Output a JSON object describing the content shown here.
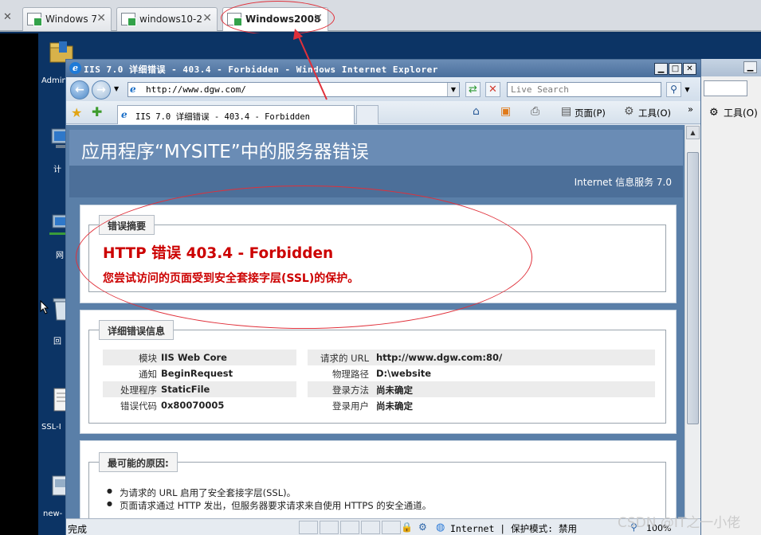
{
  "vm_tabs": [
    {
      "label": "Windows 7",
      "close": "✕"
    },
    {
      "label": "windows10-2",
      "close": "✕"
    },
    {
      "label": "Windows2008",
      "close": "✕"
    }
  ],
  "vm_tab_left_close": "✕",
  "desktop": {
    "icon_labels": [
      "Admin",
      "计",
      "网",
      "回",
      "SSL-I",
      "new-"
    ]
  },
  "ie": {
    "title": "IIS 7.0 详细错误 - 403.4 - Forbidden - Windows Internet Explorer",
    "address": "http://www.dgw.com/",
    "search_placeholder": "Live Search",
    "tab_label": "IIS 7.0 详细错误 - 403.4 - Forbidden",
    "commands": {
      "page": "页面(P)",
      "tools": "工具(O)",
      "more": "»"
    },
    "status": {
      "done": "完成",
      "zone": "Internet | 保护模式: 禁用",
      "zoom": "100%"
    }
  },
  "bg_window": {
    "tools_label": "工具(O)"
  },
  "page": {
    "header_title": "应用程序“MYSITE”中的服务器错误",
    "header_sub": "Internet 信息服务 7.0",
    "summary": {
      "legend": "错误摘要",
      "error_title": "HTTP 错误 403.4 - Forbidden",
      "error_desc": "您尝试访问的页面受到安全套接字层(SSL)的保护。"
    },
    "detail": {
      "legend": "详细错误信息",
      "left": [
        {
          "label": "模块",
          "value": "IIS Web Core"
        },
        {
          "label": "通知",
          "value": "BeginRequest"
        },
        {
          "label": "处理程序",
          "value": "StaticFile"
        },
        {
          "label": "错误代码",
          "value": "0x80070005"
        }
      ],
      "right": [
        {
          "label": "请求的 URL",
          "value": "http://www.dgw.com:80/"
        },
        {
          "label": "物理路径",
          "value": "D:\\website"
        },
        {
          "label": "登录方法",
          "value": "尚未确定"
        },
        {
          "label": "登录用户",
          "value": "尚未确定"
        }
      ]
    },
    "causes": {
      "legend": "最可能的原因:",
      "items": [
        "为请求的 URL 启用了安全套接字层(SSL)。",
        "页面请求通过 HTTP 发出，但服务器要求请求来自使用 HTTPS 的安全通道。"
      ]
    }
  },
  "watermark": "CSDN @IT之一小佬",
  "colors": {
    "annotation_red": "#e0303a",
    "error_red": "#cc0000",
    "header_blue": "#6a8cb5"
  }
}
